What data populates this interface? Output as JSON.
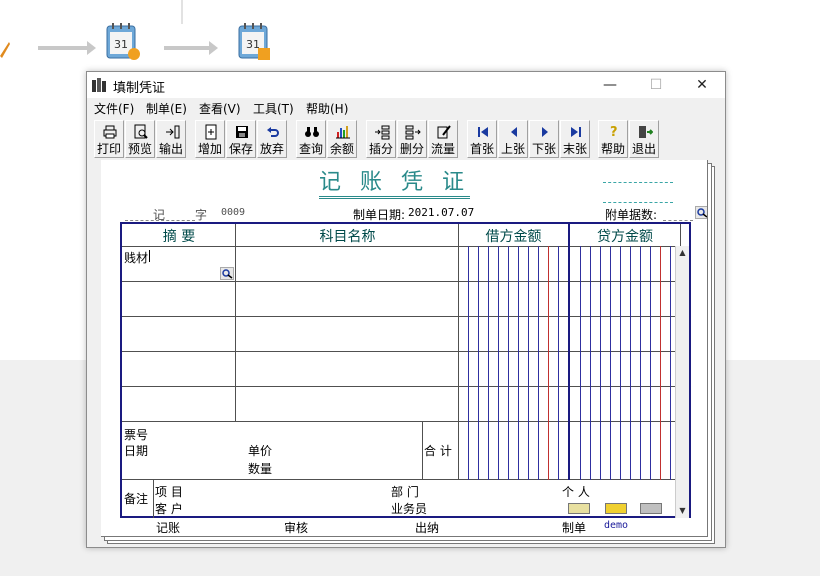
{
  "window": {
    "title": "填制凭证",
    "minimize": "—",
    "maximize": "☐",
    "close": "✕"
  },
  "menu": [
    "文件(F)",
    "制单(E)",
    "查看(V)",
    "工具(T)",
    "帮助(H)"
  ],
  "toolbar": [
    "打印",
    "预览",
    "输出",
    "增加",
    "保存",
    "放弃",
    "查询",
    "余额",
    "插分",
    "删分",
    "流量",
    "首张",
    "上张",
    "下张",
    "末张",
    "帮助",
    "退出"
  ],
  "voucher": {
    "title": "记 账 凭 证",
    "type_label": "记",
    "zi_label": "字",
    "number": "0009",
    "date_label": "制单日期:",
    "date": "2021.07.07",
    "attach_label": "附单据数:",
    "col_summary": "摘 要",
    "col_account": "科目名称",
    "col_debit": "借方金额",
    "col_credit": "贷方金额",
    "row1_summary": "贱材",
    "ticket_label": "票号",
    "date_row_label": "日期",
    "unit_price_label": "单价",
    "quantity_label": "数量",
    "total_label": "合 计",
    "remark_label": "备注",
    "project_label": "项  目",
    "customer_label": "客  户",
    "department_label": "部  门",
    "salesperson_label": "业务员",
    "person_label": "个  人",
    "bookkeeper_label": "记账",
    "reviewer_label": "审核",
    "cashier_label": "出纳",
    "preparer_label": "制单",
    "preparer_name": "demo"
  }
}
